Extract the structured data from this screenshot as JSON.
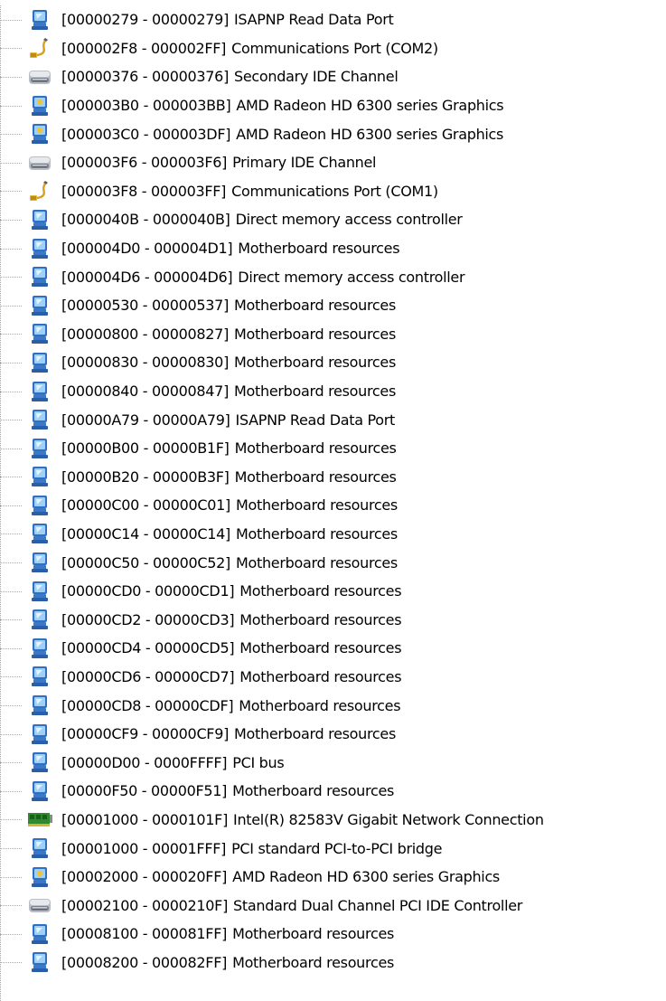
{
  "colors": {
    "text": "#000000",
    "tree_line": "#a8a8a8",
    "monitor_blue": "#3a78c8",
    "monitor_screen": "#8fc6f4"
  },
  "tree": {
    "items": [
      {
        "range": "[00000279 - 00000279]",
        "name": "ISAPNP Read Data Port",
        "icon": "system-device-icon"
      },
      {
        "range": "[000002F8 - 000002FF]",
        "name": "Communications Port (COM2)",
        "icon": "port-icon"
      },
      {
        "range": "[00000376 - 00000376]",
        "name": "Secondary IDE Channel",
        "icon": "ide-drive-icon"
      },
      {
        "range": "[000003B0 - 000003BB]",
        "name": "AMD Radeon HD 6300 series Graphics",
        "icon": "display-adapter-icon"
      },
      {
        "range": "[000003C0 - 000003DF]",
        "name": "AMD Radeon HD 6300 series Graphics",
        "icon": "display-adapter-icon"
      },
      {
        "range": "[000003F6 - 000003F6]",
        "name": "Primary IDE Channel",
        "icon": "ide-drive-icon"
      },
      {
        "range": "[000003F8 - 000003FF]",
        "name": "Communications Port (COM1)",
        "icon": "port-icon"
      },
      {
        "range": "[0000040B - 0000040B]",
        "name": "Direct memory access controller",
        "icon": "system-device-icon"
      },
      {
        "range": "[000004D0 - 000004D1]",
        "name": "Motherboard resources",
        "icon": "system-device-icon"
      },
      {
        "range": "[000004D6 - 000004D6]",
        "name": "Direct memory access controller",
        "icon": "system-device-icon"
      },
      {
        "range": "[00000530 - 00000537]",
        "name": "Motherboard resources",
        "icon": "system-device-icon"
      },
      {
        "range": "[00000800 - 00000827]",
        "name": "Motherboard resources",
        "icon": "system-device-icon"
      },
      {
        "range": "[00000830 - 00000830]",
        "name": "Motherboard resources",
        "icon": "system-device-icon"
      },
      {
        "range": "[00000840 - 00000847]",
        "name": "Motherboard resources",
        "icon": "system-device-icon"
      },
      {
        "range": "[00000A79 - 00000A79]",
        "name": "ISAPNP Read Data Port",
        "icon": "system-device-icon"
      },
      {
        "range": "[00000B00 - 00000B1F]",
        "name": "Motherboard resources",
        "icon": "system-device-icon"
      },
      {
        "range": "[00000B20 - 00000B3F]",
        "name": "Motherboard resources",
        "icon": "system-device-icon"
      },
      {
        "range": "[00000C00 - 00000C01]",
        "name": "Motherboard resources",
        "icon": "system-device-icon"
      },
      {
        "range": "[00000C14 - 00000C14]",
        "name": "Motherboard resources",
        "icon": "system-device-icon"
      },
      {
        "range": "[00000C50 - 00000C52]",
        "name": "Motherboard resources",
        "icon": "system-device-icon"
      },
      {
        "range": "[00000CD0 - 00000CD1]",
        "name": "Motherboard resources",
        "icon": "system-device-icon"
      },
      {
        "range": "[00000CD2 - 00000CD3]",
        "name": "Motherboard resources",
        "icon": "system-device-icon"
      },
      {
        "range": "[00000CD4 - 00000CD5]",
        "name": "Motherboard resources",
        "icon": "system-device-icon"
      },
      {
        "range": "[00000CD6 - 00000CD7]",
        "name": "Motherboard resources",
        "icon": "system-device-icon"
      },
      {
        "range": "[00000CD8 - 00000CDF]",
        "name": "Motherboard resources",
        "icon": "system-device-icon"
      },
      {
        "range": "[00000CF9 - 00000CF9]",
        "name": "Motherboard resources",
        "icon": "system-device-icon"
      },
      {
        "range": "[00000D00 - 0000FFFF]",
        "name": "PCI bus",
        "icon": "system-device-icon"
      },
      {
        "range": "[00000F50 - 00000F51]",
        "name": "Motherboard resources",
        "icon": "system-device-icon"
      },
      {
        "range": "[00001000 - 0000101F]",
        "name": "Intel(R) 82583V Gigabit Network Connection",
        "icon": "network-adapter-icon"
      },
      {
        "range": "[00001000 - 00001FFF]",
        "name": "PCI standard PCI-to-PCI bridge",
        "icon": "system-device-icon"
      },
      {
        "range": "[00002000 - 000020FF]",
        "name": "AMD Radeon HD 6300 series Graphics",
        "icon": "display-adapter-icon"
      },
      {
        "range": "[00002100 - 0000210F]",
        "name": "Standard Dual Channel PCI IDE Controller",
        "icon": "ide-drive-icon"
      },
      {
        "range": "[00008100 - 000081FF]",
        "name": "Motherboard resources",
        "icon": "system-device-icon"
      },
      {
        "range": "[00008200 - 000082FF]",
        "name": "Motherboard resources",
        "icon": "system-device-icon"
      }
    ]
  }
}
